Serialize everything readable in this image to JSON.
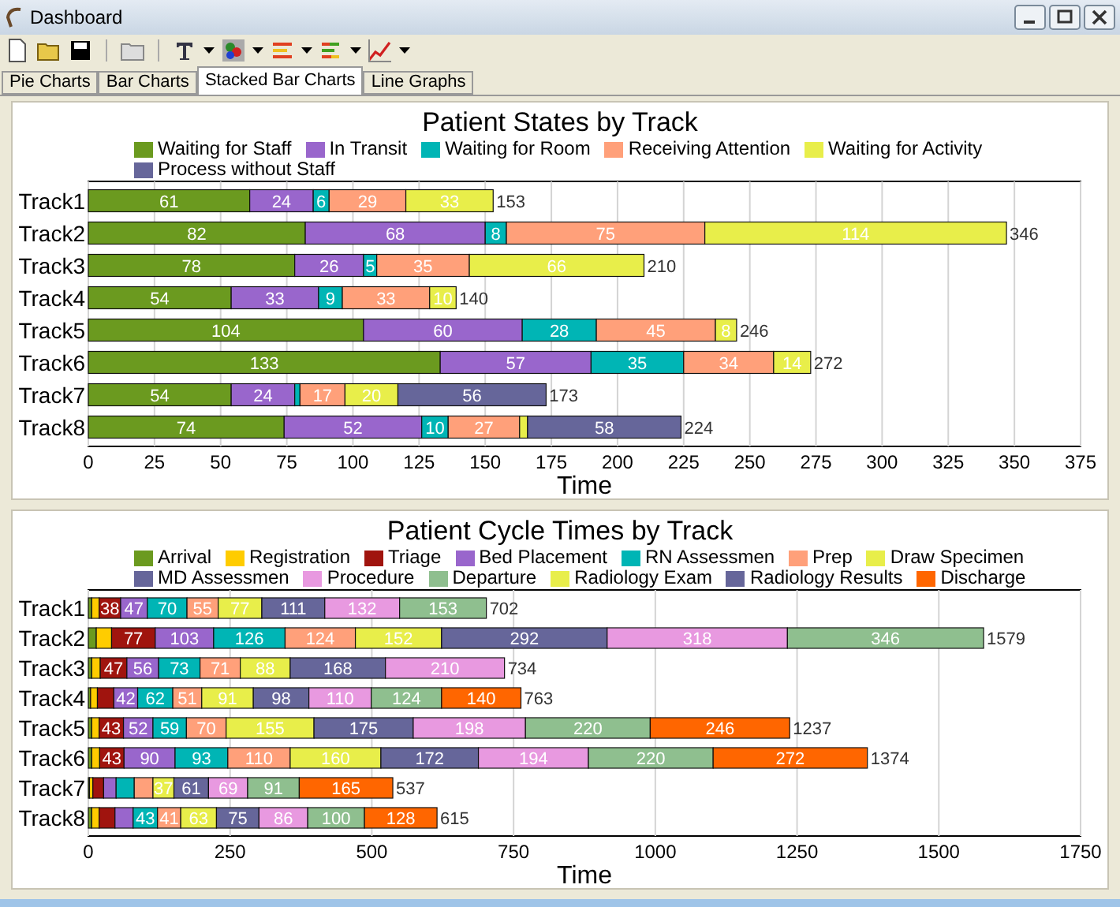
{
  "window": {
    "title": "Dashboard"
  },
  "tabs": [
    {
      "label": "Pie Charts",
      "selected": false
    },
    {
      "label": "Bar Charts",
      "selected": false
    },
    {
      "label": "Stacked Bar Charts",
      "selected": true
    },
    {
      "label": "Line Graphs",
      "selected": false
    }
  ],
  "charts": [
    {
      "chart_data": {
        "type": "bar",
        "orientation": "horizontal",
        "stacked": true,
        "grid": true,
        "legend": "top",
        "title": "Patient States by Track",
        "xlabel": "Time",
        "categories": [
          "Track1",
          "Track2",
          "Track3",
          "Track4",
          "Track5",
          "Track6",
          "Track7",
          "Track8"
        ],
        "series": [
          {
            "name": "Waiting for Staff",
            "color": "#6b9a1f",
            "values": [
              61,
              82,
              78,
              54,
              104,
              133,
              54,
              74
            ]
          },
          {
            "name": "In Transit",
            "color": "#9966cc",
            "values": [
              24,
              68,
              26,
              33,
              60,
              57,
              24,
              52
            ]
          },
          {
            "name": "Waiting for Room",
            "color": "#00b5b5",
            "values": [
              6,
              8,
              5,
              9,
              28,
              35,
              2,
              10
            ]
          },
          {
            "name": "Receiving Attention",
            "color": "#ffa07a",
            "values": [
              29,
              75,
              35,
              33,
              45,
              34,
              17,
              27
            ]
          },
          {
            "name": "Waiting for Activity",
            "color": "#e8ee4a",
            "values": [
              33,
              114,
              66,
              10,
              8,
              14,
              20,
              3
            ]
          },
          {
            "name": "Process without Staff",
            "color": "#66669a",
            "values": [
              null,
              null,
              null,
              null,
              null,
              null,
              56,
              58
            ]
          }
        ],
        "value_labels": [
          [
            "61",
            "82",
            "78",
            "54",
            "104",
            "133",
            "54",
            "74"
          ],
          [
            "24",
            "68",
            "26",
            "33",
            "60",
            "57",
            "24",
            "52"
          ],
          [
            "6",
            "8",
            "5",
            "9",
            "28",
            "35",
            null,
            "10"
          ],
          [
            "29",
            "75",
            "35",
            "33",
            "45",
            "34",
            "17",
            "27"
          ],
          [
            "33",
            "114",
            "66",
            "10",
            "8",
            "14",
            "20",
            null
          ],
          [
            null,
            null,
            null,
            null,
            null,
            null,
            "56",
            "58"
          ]
        ],
        "xlim": [
          0,
          375
        ],
        "xticks": [
          0,
          25,
          50,
          75,
          100,
          125,
          150,
          175,
          200,
          225,
          250,
          275,
          300,
          325,
          350,
          375
        ]
      },
      "totals": [
        "153",
        "346",
        "210",
        "140",
        "246",
        "272",
        "173",
        "224"
      ]
    },
    {
      "chart_data": {
        "type": "bar",
        "orientation": "horizontal",
        "stacked": true,
        "grid": true,
        "legend": "top",
        "title": "Patient Cycle Times by Track",
        "xlabel": "Time",
        "categories": [
          "Track1",
          "Track2",
          "Track3",
          "Track4",
          "Track5",
          "Track6",
          "Track7",
          "Track8"
        ],
        "series": [
          {
            "name": "Arrival",
            "color": "#6b9a1f",
            "values": [
              6,
              14,
              6,
              4,
              6,
              6,
              2,
              6
            ]
          },
          {
            "name": "Registration",
            "color": "#ffcc00",
            "values": [
              13,
              27,
              15,
              12,
              13,
              14,
              6,
              13
            ]
          },
          {
            "name": "Triage",
            "color": "#a0140e",
            "values": [
              38,
              77,
              47,
              29,
              43,
              43,
              19,
              28
            ]
          },
          {
            "name": "Bed Placement",
            "color": "#9966cc",
            "values": [
              47,
              103,
              56,
              42,
              52,
              90,
              22,
              32
            ]
          },
          {
            "name": "RN Assessmen",
            "color": "#00b5b5",
            "values": [
              70,
              126,
              73,
              62,
              59,
              93,
              32,
              43
            ]
          },
          {
            "name": "Prep",
            "color": "#ffa07a",
            "values": [
              55,
              124,
              71,
              51,
              70,
              110,
              33,
              41
            ]
          },
          {
            "name": "Draw Specimen",
            "color": "#e8ee4a",
            "values": [
              77,
              152,
              88,
              91,
              155,
              160,
              37,
              63
            ]
          },
          {
            "name": "MD Assessmen",
            "color": "#66669a",
            "values": [
              111,
              292,
              168,
              98,
              175,
              172,
              61,
              75
            ]
          },
          {
            "name": "Procedure",
            "color": "#e899e0",
            "values": [
              132,
              318,
              210,
              110,
              198,
              194,
              69,
              86
            ]
          },
          {
            "name": "Departure",
            "color": "#8fbf8f",
            "values": [
              153,
              346,
              null,
              124,
              220,
              220,
              91,
              100
            ]
          },
          {
            "name": "Radiology Exam",
            "color": "#e8ee4a",
            "values": [
              null,
              null,
              null,
              null,
              null,
              null,
              null,
              null
            ]
          },
          {
            "name": "Radiology Results",
            "color": "#66669a",
            "values": [
              null,
              null,
              null,
              null,
              null,
              null,
              null,
              null
            ]
          },
          {
            "name": "Discharge",
            "color": "#ff6600",
            "values": [
              null,
              null,
              null,
              140,
              246,
              272,
              165,
              128
            ]
          }
        ],
        "value_labels": [
          [
            null,
            null,
            null,
            null,
            null,
            null,
            null,
            null
          ],
          [
            null,
            null,
            null,
            null,
            null,
            null,
            null,
            null
          ],
          [
            "38",
            "77",
            "47",
            null,
            "43",
            "43",
            null,
            null
          ],
          [
            "47",
            "103",
            "56",
            "42",
            "52",
            "90",
            null,
            null
          ],
          [
            "70",
            "126",
            "73",
            "62",
            "59",
            "93",
            null,
            "43"
          ],
          [
            "55",
            "124",
            "71",
            "51",
            "70",
            "110",
            null,
            "41"
          ],
          [
            "77",
            "152",
            "88",
            "91",
            "155",
            "160",
            "37",
            "63"
          ],
          [
            "111",
            "292",
            "168",
            "98",
            "175",
            "172",
            "61",
            "75"
          ],
          [
            "132",
            "318",
            "210",
            "110",
            "198",
            "194",
            "69",
            "86"
          ],
          [
            "153",
            "346",
            null,
            "124",
            "220",
            "220",
            "91",
            "100"
          ],
          [
            null,
            null,
            null,
            null,
            null,
            null,
            null,
            null
          ],
          [
            null,
            null,
            null,
            null,
            null,
            null,
            null,
            null
          ],
          [
            null,
            null,
            null,
            "140",
            "246",
            "272",
            "165",
            "128"
          ]
        ],
        "xlim": [
          0,
          1750
        ],
        "xticks": [
          0,
          250,
          500,
          750,
          1000,
          1250,
          1500,
          1750
        ]
      },
      "totals": [
        "702",
        "1579",
        "734",
        "763",
        "1237",
        "1374",
        "537",
        "615"
      ]
    }
  ]
}
